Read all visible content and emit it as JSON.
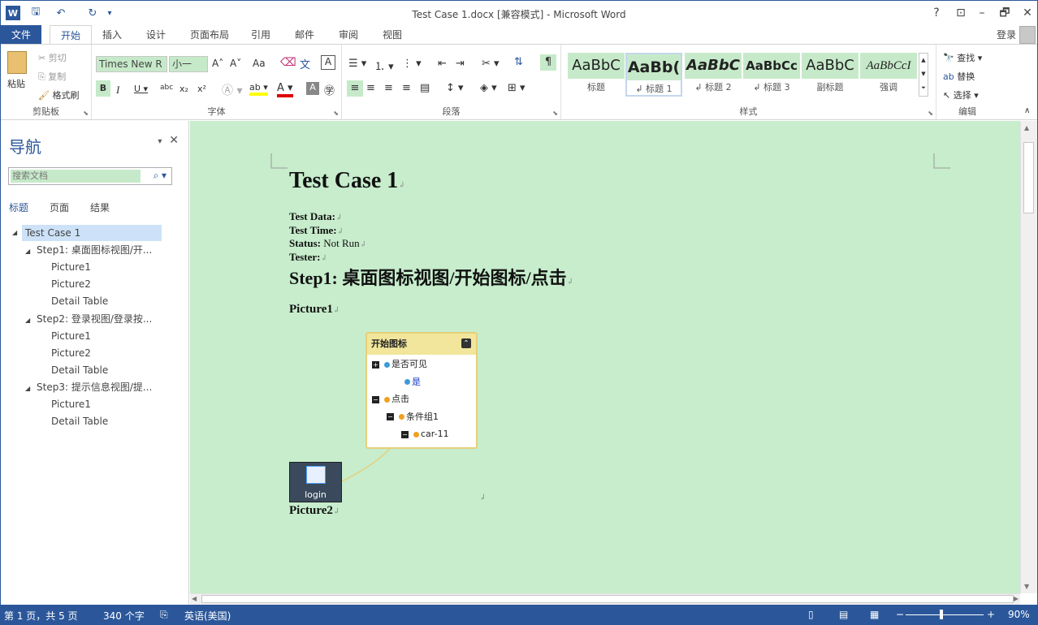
{
  "window": {
    "title": "Test Case 1.docx [兼容模式] - Microsoft Word",
    "help": "?",
    "restore": "⊡",
    "minimize": "–",
    "maximize": "🗗",
    "close": "✕"
  },
  "tabs": {
    "items": [
      "文件",
      "开始",
      "插入",
      "设计",
      "页面布局",
      "引用",
      "邮件",
      "审阅",
      "视图"
    ],
    "login": "登录"
  },
  "ribbon": {
    "clipboard": {
      "label": "剪贴板",
      "paste": "粘贴",
      "cut": "剪切",
      "copy": "复制",
      "format_painter": "格式刷"
    },
    "font": {
      "label": "字体",
      "font_name": "Times New R",
      "font_size": "小一",
      "aa": "Aa",
      "grow": "A˄",
      "shrink": "A˅"
    },
    "paragraph": {
      "label": "段落"
    },
    "styles": {
      "label": "样式",
      "items": [
        {
          "sample": "AaBbC",
          "name": "标题"
        },
        {
          "sample": "AaBb(",
          "name": "↲ 标题 1"
        },
        {
          "sample": "AaBbC",
          "name": "↲ 标题 2"
        },
        {
          "sample": "AaBbCc",
          "name": "↲ 标题 3"
        },
        {
          "sample": "AaBbC",
          "name": "副标题"
        },
        {
          "sample": "AaBbCcI",
          "name": "强调"
        }
      ]
    },
    "editing": {
      "label": "编辑",
      "find": "查找",
      "replace": "替换",
      "select": "选择"
    }
  },
  "nav": {
    "title": "导航",
    "search_placeholder": "搜索文档",
    "tabs": [
      "标题",
      "页面",
      "结果"
    ],
    "tree": [
      {
        "label": "Test Case 1",
        "level": 0,
        "expander": true,
        "selected": true
      },
      {
        "label": "Step1: 桌面图标视图/开...",
        "level": 1,
        "expander": true
      },
      {
        "label": "Picture1",
        "level": 2
      },
      {
        "label": "Picture2",
        "level": 2
      },
      {
        "label": "Detail Table",
        "level": 2
      },
      {
        "label": "Step2: 登录视图/登录按...",
        "level": 1,
        "expander": true
      },
      {
        "label": "Picture1",
        "level": 2
      },
      {
        "label": "Picture2",
        "level": 2
      },
      {
        "label": "Detail Table",
        "level": 2
      },
      {
        "label": "Step3: 提示信息视图/提...",
        "level": 1,
        "expander": true
      },
      {
        "label": "Picture1",
        "level": 2
      },
      {
        "label": "Detail Table",
        "level": 2
      }
    ]
  },
  "doc": {
    "title": "Test Case 1",
    "fields": [
      {
        "label": "Test Data:",
        "value": ""
      },
      {
        "label": "Test Time:",
        "value": ""
      },
      {
        "label": "Status:",
        "value": " Not Run"
      },
      {
        "label": "Tester:",
        "value": ""
      }
    ],
    "step_heading": "Step1: 桌面图标视图/开始图标/点击",
    "picture1": "Picture1",
    "picture2": "Picture2",
    "card": {
      "title": "开始图标",
      "rows": [
        {
          "label": "是否可见",
          "toggle": "+",
          "dot_color": "#3c9bd8",
          "indent": 0
        },
        {
          "label": "是",
          "dot_color": "#3c9bd8",
          "indent": 1,
          "text_color": "#1a3cc9"
        },
        {
          "label": "点击",
          "toggle": "−",
          "dot_color": "#f0a020",
          "indent": 0
        },
        {
          "label": "条件组1",
          "toggle": "−",
          "dot_color": "#f0a020",
          "indent": 1
        },
        {
          "label": "car-11",
          "toggle": "−",
          "dot_color": "#f0a020",
          "indent": 2
        }
      ]
    },
    "login_icon_label": "login"
  },
  "status": {
    "page": "第 1 页，共 5 页",
    "words": "340 个字",
    "lang": "英语(美国)",
    "zoom": "90%"
  },
  "colors": {
    "accent": "#2b579a",
    "doc_bg": "#c7edcc"
  }
}
